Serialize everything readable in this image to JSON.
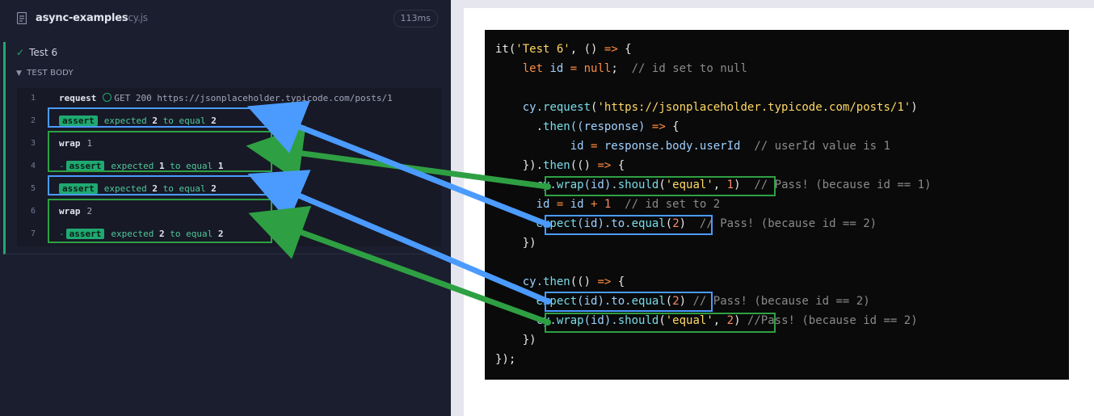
{
  "header": {
    "spec_name": "async-examples",
    "spec_ext": "cy.js",
    "duration": "113ms"
  },
  "test": {
    "title": "Test 6",
    "section": "TEST BODY"
  },
  "commands": [
    {
      "num": "1",
      "name": "request",
      "method": "GET 200",
      "url": "https://jsonplaceholder.typicode.com/posts/1"
    },
    {
      "num": "2",
      "badge": "assert",
      "prefix": "expected",
      "v1": "2",
      "mid": "to equal",
      "v2": "2"
    },
    {
      "num": "3",
      "name": "wrap",
      "arg": "1"
    },
    {
      "num": "4",
      "dash": "-",
      "badge": "assert",
      "prefix": "expected",
      "v1": "1",
      "mid": "to equal",
      "v2": "1"
    },
    {
      "num": "5",
      "badge": "assert",
      "prefix": "expected",
      "v1": "2",
      "mid": "to equal",
      "v2": "2"
    },
    {
      "num": "6",
      "name": "wrap",
      "arg": "2"
    },
    {
      "num": "7",
      "dash": "-",
      "badge": "assert",
      "prefix": "expected",
      "v1": "2",
      "mid": "to equal",
      "v2": "2"
    }
  ],
  "code": {
    "l1": {
      "a": "it(",
      "b": "'Test 6'",
      "c": ", () ",
      "d": "=>",
      "e": " {"
    },
    "l2": {
      "a": "    ",
      "b": "let",
      "c": " id ",
      "d": "=",
      "e": " null",
      "f": ";  ",
      "g": "// id set to null"
    },
    "l4": {
      "a": "    cy.",
      "b": "request",
      "c": "(",
      "d": "'https://jsonplaceholder.typicode.com/posts/1'",
      "e": ")"
    },
    "l5": {
      "a": "      .",
      "b": "then",
      "c": "((response) ",
      "d": "=>",
      "e": " {"
    },
    "l6": {
      "a": "           id ",
      "b": "=",
      "c": " response.body.userId  ",
      "d": "// userId value is 1"
    },
    "l7": {
      "a": "    }).",
      "b": "then",
      "c": "(() ",
      "d": "=>",
      "e": " {"
    },
    "l8": {
      "a": "      cy.",
      "b": "wrap",
      "c": "(id).",
      "d": "should",
      "e": "(",
      "f": "'equal'",
      "g": ", ",
      "h": "1",
      "i": ")",
      "j": "  // Pass! (because id == 1)"
    },
    "l9": {
      "a": "      id ",
      "b": "=",
      "c": " id ",
      "d": "+",
      "e": " 1",
      "f": "  // id set to 2"
    },
    "l10": {
      "a": "      ",
      "b": "expect",
      "c": "(id).to.",
      "d": "equal",
      "e": "(",
      "f": "2",
      "g": ")",
      "h": "  // Pass! (because id == 2)"
    },
    "l11": {
      "a": "    })"
    },
    "l13": {
      "a": "    cy.",
      "b": "then",
      "c": "(() ",
      "d": "=>",
      "e": " {"
    },
    "l14": {
      "a": "      ",
      "b": "expect",
      "c": "(id).to.",
      "d": "equal",
      "e": "(",
      "f": "2",
      "g": ")",
      "h": " // Pass! (because id == 2)"
    },
    "l15": {
      "a": "      cy.",
      "b": "wrap",
      "c": "(id).",
      "d": "should",
      "e": "(",
      "f": "'equal'",
      "g": ", ",
      "h": "2",
      "i": ")",
      "j": " //Pass! (because id == 2)"
    },
    "l16": {
      "a": "    })"
    },
    "l17": {
      "a": "});"
    }
  },
  "colors": {
    "pass_green": "#1fa971",
    "blue_highlight": "#4b9bff",
    "green_highlight": "#2ea043"
  }
}
